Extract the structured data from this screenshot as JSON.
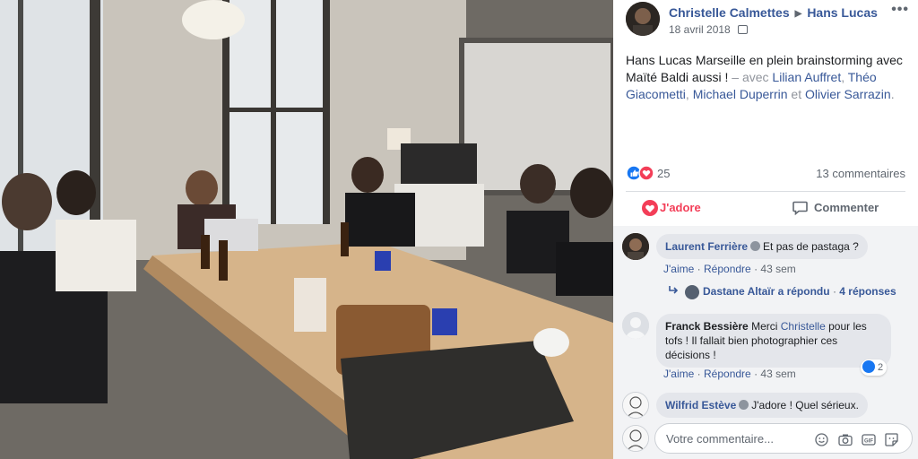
{
  "post": {
    "author": "Christelle Calmettes",
    "target": "Hans Lucas",
    "date": "18 avril 2018",
    "more_label": "•••",
    "caption": {
      "text": "Hans Lucas Marseille en plein brainstorming avec Maïté Baldi aussi !",
      "with_prefix": " – avec ",
      "tag1": "Lilian Auffret",
      "sep1": ", ",
      "tag2": "Théo Giacometti",
      "sep2": ", ",
      "tag3": "Michael Duperrin",
      "sep3": " et ",
      "tag4": "Olivier Sarrazin",
      "end": "."
    },
    "reactions_count": "25",
    "comments_count": "13 commentaires",
    "actions": {
      "love": "J'adore",
      "comment": "Commenter"
    }
  },
  "comments": [
    {
      "author": "Laurent Ferrière",
      "text": "Et pas de pastaga ?",
      "like": "J'aime",
      "reply": "Répondre",
      "time": "43 sem",
      "sep": "·"
    },
    {
      "author": "Franck Bessière",
      "mention": "Christelle",
      "text_before": "Merci ",
      "text_after": " pour les tofs ! Il fallait bien photographier ces décisions !",
      "like": "J'aime",
      "reply": "Répondre",
      "time": "43 sem",
      "sep": "·",
      "likes": "2"
    },
    {
      "author": "Wilfrid Estève",
      "text": "J'adore ! Quel sérieux."
    }
  ],
  "replies_line": {
    "text": "Dastane Altaïr a répondu",
    "sep": "·",
    "count": "4 réponses"
  },
  "composer": {
    "placeholder": "Votre commentaire..."
  },
  "colors": {
    "link": "#385898",
    "love": "#f33e58",
    "like": "#1877f2",
    "bubble": "#e4e6eb"
  }
}
